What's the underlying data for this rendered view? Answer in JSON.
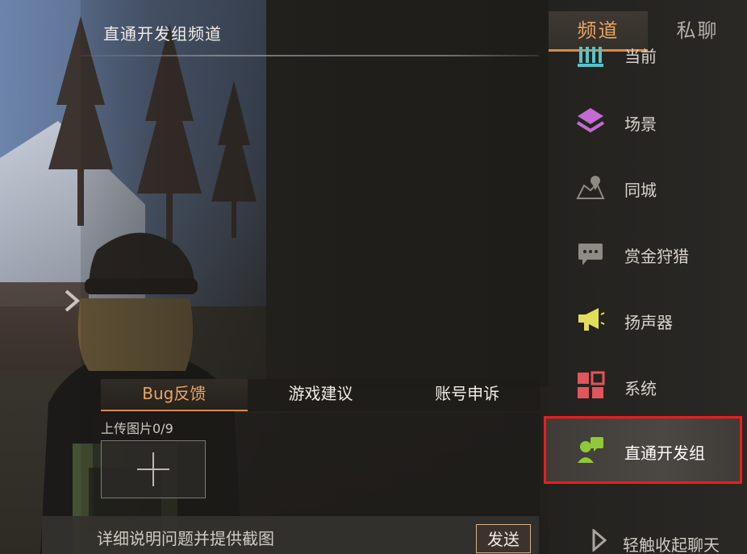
{
  "channel_header": {
    "title": "直通开发组频道"
  },
  "feedback": {
    "tabs": [
      {
        "label": "Bug反馈",
        "active": true
      },
      {
        "label": "游戏建议",
        "active": false
      },
      {
        "label": "账号申诉",
        "active": false
      }
    ],
    "upload_label": "上传图片0/9"
  },
  "input": {
    "placeholder": "详细说明问题并提供截图",
    "send_label": "发送"
  },
  "sidebar": {
    "top_tabs": [
      {
        "label": "频道",
        "active": true
      },
      {
        "label": "私聊",
        "active": false
      }
    ],
    "channels": [
      {
        "label": "当前",
        "icon": "building-icon",
        "color": "#59c2c9"
      },
      {
        "label": "场景",
        "icon": "layers-icon",
        "color": "#c36bd1"
      },
      {
        "label": "同城",
        "icon": "map-pin-icon",
        "color": "#8e8a84"
      },
      {
        "label": "赏金狩猎",
        "icon": "chat-dots-icon",
        "color": "#8e8a84"
      },
      {
        "label": "扬声器",
        "icon": "megaphone-icon",
        "color": "#e3de5a"
      },
      {
        "label": "系统",
        "icon": "grid-icon",
        "color": "#e0565a"
      },
      {
        "label": "直通开发组",
        "icon": "dev-group-icon",
        "color": "#8ec93a",
        "selected": true
      }
    ],
    "collapse_label": "轻触收起聊天"
  },
  "colors": {
    "accent": "#e9a564",
    "highlight_border": "#ee1c1c"
  }
}
